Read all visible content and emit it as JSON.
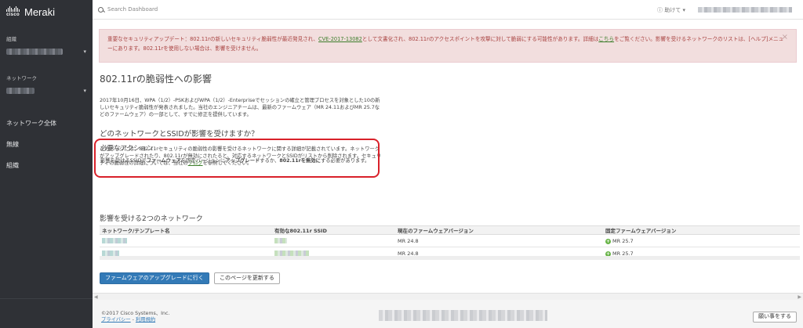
{
  "sidebar": {
    "logo_cisco": "cisco",
    "logo_meraki": "Meraki",
    "org_label": "組織",
    "network_label": "ネットワーク",
    "nav": [
      "ネットワーク全体",
      "無線",
      "組織"
    ]
  },
  "topbar": {
    "search_placeholder": "Search Dashboard",
    "help_label": "助けて ▾"
  },
  "alert": {
    "text_before_link": "重要なセキュリティアップデート：802.11rの新しいセキュリティ脆弱性が最近発見され、",
    "cve_link": "CVE-2017-13082",
    "text_after_link": "として文書化され、802.11rのアクセスポイントを攻撃に対して脆弱にする可能性があります。詳細は",
    "here_link": "こちら",
    "text_line2_a": "をご覧ください。影響を受けるネットワークのリストは、[ヘルプ]メニューにあります。802.11rを使用しない場合は、影響を受けません。",
    "close": "×"
  },
  "main": {
    "title": "802.11rの脆弱性への影響",
    "intro": "2017年10月16日、WPA（1/2）-PSKおよびWPA（1/2）-Enterpriseでセッションの確立と管理プロセスを対象とした10の新しいセキュリティ脆弱性が発表されました。当社のエンジニアチームは、最新のファームウェア（MR 24.11およびMR 25.7などのファームウェア）の一部として、すでに修正を提供しています。",
    "q_title": "どのネットワークとSSIDが影響を受けますか？",
    "q_text_a": "このページには、802.11rセキュリティの脆弱性の影響を受けるネットワークに関する詳細が記載されています。ネットワークがアップグレードされたり、802.11rが無効にされたると、対応するネットワークとSSIDがリストから削除されます。セキュリティの脆弱性の詳細については、当社の",
    "blog_link": "ブログ",
    "q_text_b": "を参照してください。",
    "action_title": "必要なアクション",
    "action_a": "影響を受けるSSIDで",
    "action_b": "ファームウェア",
    "action_c": "を固定バージョンに",
    "action_d": "アップグレード",
    "action_e": "するか、",
    "action_f": "802.11rを無効に",
    "action_g": "する必要があります。",
    "affected_title": "影響を受ける2つのネットワーク",
    "table": {
      "headers": [
        "ネットワーク/テンプレート名",
        "有効な802.11r SSID",
        "現在のファームウェアバージョン",
        "固定ファームウェアバージョン"
      ],
      "rows": [
        {
          "current": "MR 24.8",
          "fixed": "MR 25.7"
        },
        {
          "current": "MR 24.8",
          "fixed": "MR 25.7"
        }
      ]
    },
    "upgrade_button": "ファームウェアのアップグレードに行く",
    "refresh_button": "このページを更新する"
  },
  "footer": {
    "copyright": "©2017 Cisco Systems、Inc.",
    "privacy": "プライバシー",
    "sep": " - ",
    "terms": "利用規約",
    "help_button": "願い事をする"
  }
}
